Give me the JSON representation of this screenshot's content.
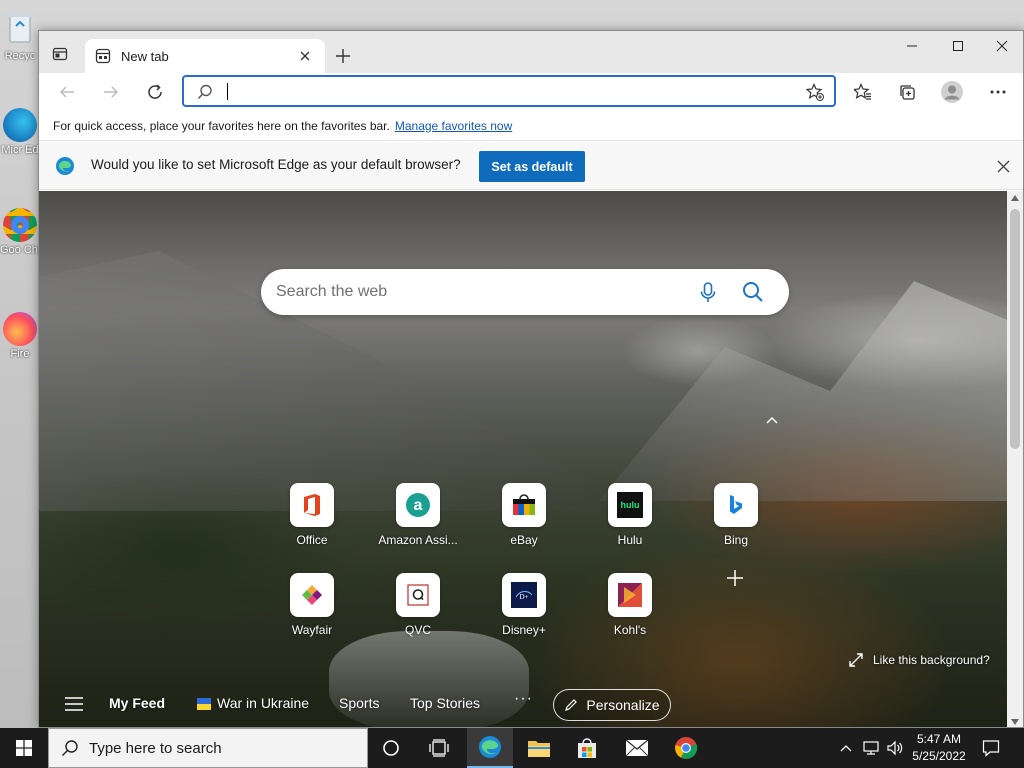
{
  "desktop": {
    "icons": [
      {
        "label": "Recycle Bin",
        "visible_label": "Recyc"
      },
      {
        "label": "Microsoft Edge",
        "visible_label": "Micr Ed"
      },
      {
        "label": "Google Chrome",
        "visible_label": "Goo Chr"
      },
      {
        "label": "Firefox",
        "visible_label": "Fire"
      }
    ]
  },
  "browser": {
    "tab": {
      "title": "New tab",
      "icon": "new-tab-page-icon"
    },
    "address_bar": {
      "value": "",
      "placeholder": ""
    },
    "favorites_bar": {
      "message": "For quick access, place your favorites here on the favorites bar.",
      "link": "Manage favorites now"
    },
    "infobar": {
      "message": "Would you like to set Microsoft Edge as your default browser?",
      "button": "Set as default"
    },
    "new_tab_page": {
      "search_placeholder": "Search the web",
      "quick_links": [
        {
          "label": "Office",
          "icon": "office-icon"
        },
        {
          "label": "Amazon Assi...",
          "icon": "amazon-assistant-icon"
        },
        {
          "label": "eBay",
          "icon": "ebay-icon"
        },
        {
          "label": "Hulu",
          "icon": "hulu-icon"
        },
        {
          "label": "Bing",
          "icon": "bing-icon"
        },
        {
          "label": "Wayfair",
          "icon": "wayfair-icon"
        },
        {
          "label": "QVC",
          "icon": "qvc-icon"
        },
        {
          "label": "Disney+",
          "icon": "disney-plus-icon"
        },
        {
          "label": "Kohl's",
          "icon": "kohls-icon"
        }
      ],
      "hulu_text": "hulu",
      "like_background": "Like this background?",
      "feed": {
        "my_feed": "My Feed",
        "war_in_ukraine": "War in Ukraine",
        "sports": "Sports",
        "top_stories": "Top Stories",
        "more": "···",
        "personalize": "Personalize"
      }
    }
  },
  "taskbar": {
    "search_placeholder": "Type here to search",
    "time": "5:47 AM",
    "date": "5/25/2022"
  },
  "colors": {
    "accent": "#0f6cbd",
    "address_focus": "#2a6ad1",
    "link": "#1158b8",
    "taskbar": "#1c1c1c"
  }
}
